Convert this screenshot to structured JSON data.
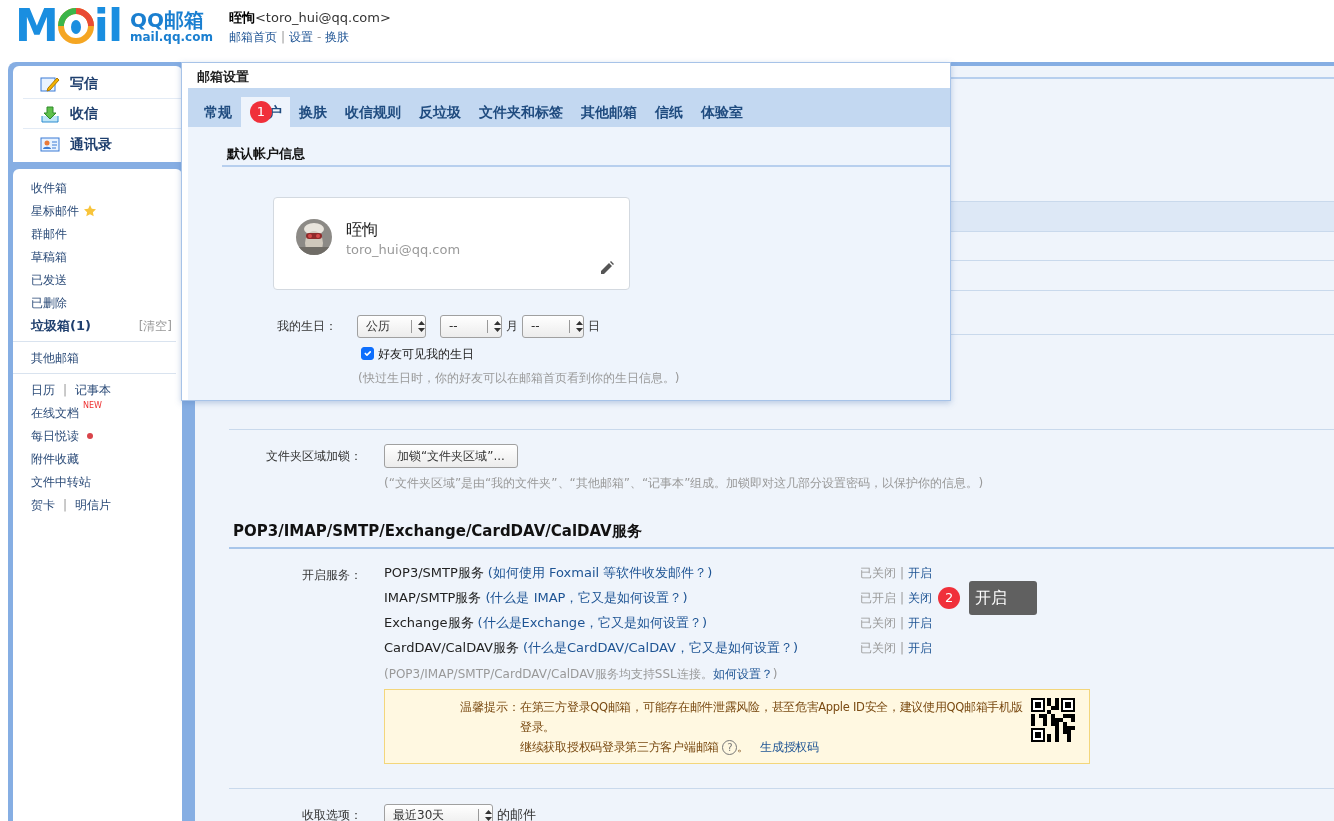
{
  "header": {
    "logo": {
      "mark_left": "M",
      "mark_right": "il",
      "name": "QQ邮箱",
      "domain": "mail.qq.com"
    },
    "user": {
      "name": "晊恂",
      "email": "<toro_hui@qq.com>"
    },
    "links": [
      {
        "kind": "link",
        "text": "邮箱首页"
      },
      {
        "kind": "sep",
        "text": "|"
      },
      {
        "kind": "link",
        "text": "设置"
      },
      {
        "kind": "sep",
        "text": "-"
      },
      {
        "kind": "link",
        "text": "换肤"
      }
    ]
  },
  "sidebar": {
    "actions": [
      {
        "kind": "compose",
        "label": "写信"
      },
      {
        "kind": "receive",
        "label": "收信"
      },
      {
        "kind": "contacts",
        "label": "通讯录"
      }
    ],
    "sections": [
      {
        "items": [
          {
            "kind": "plain",
            "label": "收件箱"
          },
          {
            "kind": "starred",
            "label": "星标邮件"
          },
          {
            "kind": "plain",
            "label": "群邮件"
          },
          {
            "kind": "plain",
            "label": "草稿箱"
          },
          {
            "kind": "plain",
            "label": "已发送"
          },
          {
            "kind": "plain",
            "label": "已删除"
          },
          {
            "kind": "junk",
            "label": "垃圾箱(1)",
            "action": "[清空]"
          }
        ]
      },
      {
        "items": [
          {
            "kind": "plain",
            "label": "其他邮箱"
          }
        ]
      },
      {
        "items": [
          {
            "kind": "pair",
            "labels": [
              "日历",
              "记事本"
            ],
            "separator": "|"
          },
          {
            "kind": "new",
            "label": "在线文档",
            "tag": "NEW"
          },
          {
            "kind": "dot",
            "label": "每日悦读"
          },
          {
            "kind": "plain",
            "label": "附件收藏"
          },
          {
            "kind": "plain",
            "label": "文件中转站"
          },
          {
            "kind": "pair",
            "labels": [
              "贺卡",
              "明信片"
            ],
            "separator": "|"
          }
        ]
      }
    ]
  },
  "popup": {
    "title": "邮箱设置",
    "tabs": [
      {
        "label": "常规",
        "selected": false
      },
      {
        "label": "户",
        "selected": true,
        "marker": "1"
      },
      {
        "label": "换肤",
        "selected": false
      },
      {
        "label": "收信规则",
        "selected": false
      },
      {
        "label": "反垃圾",
        "selected": false
      },
      {
        "label": "文件夹和标签",
        "selected": false
      },
      {
        "label": "其他邮箱",
        "selected": false
      },
      {
        "label": "信纸",
        "selected": false
      },
      {
        "label": "体验室",
        "selected": false
      }
    ],
    "section_title": "默认帐户信息",
    "account": {
      "name": "晊恂",
      "email": "toro_hui@qq.com"
    },
    "birthday": {
      "label": "我的生日：",
      "calendar": "公历",
      "month": "--",
      "month_unit": "月",
      "day": "--",
      "day_unit": "日",
      "visible": {
        "label": "好友可见我的生日",
        "checked": true
      },
      "hint": "(快过生日时，你的好友可以在邮箱首页看到你的生日信息。)"
    }
  },
  "folder_lock": {
    "label": "文件夹区域加锁：",
    "button": "加锁“文件夹区域”...",
    "hint": "(“文件夹区域”是由“我的文件夹”、“其他邮箱”、“记事本”组成。加锁即对这几部分设置密码，以保护你的信息。)"
  },
  "services": {
    "title": "POP3/IMAP/SMTP/Exchange/CardDAV/CalDAV服务",
    "label": "开启服务：",
    "rows": [
      {
        "name": "POP3/SMTP服务",
        "help": "(如何使用 Foxmail 等软件收发邮件？)",
        "status": "已关闭",
        "separator": "|",
        "action": "开启"
      },
      {
        "name": "IMAP/SMTP服务",
        "help": "(什么是 IMAP，它又是如何设置？)",
        "status": "已开启",
        "separator": "|",
        "action": "关闭",
        "callout": {
          "marker": "2",
          "text": "开启"
        }
      },
      {
        "name": "Exchange服务",
        "help": "(什么是Exchange，它又是如何设置？)",
        "status": "已关闭",
        "separator": "|",
        "action": "开启"
      },
      {
        "name": "CardDAV/CalDAV服务",
        "help": "(什么是CardDAV/CalDAV，它又是如何设置？)",
        "status": "已关闭",
        "separator": "|",
        "action": "开启"
      }
    ],
    "hint": {
      "text": "(POP3/IMAP/SMTP/CardDAV/CalDAV服务均支持SSL连接。",
      "link": "如何设置？",
      "tail": ")"
    },
    "notice": {
      "label": "温馨提示：",
      "line1": "在第三方登录QQ邮箱，可能存在邮件泄露风险，甚至危害Apple ID安全，建议使用QQ邮箱手机版登录。",
      "line2": "继续获取授权码登录第三方客户端邮箱",
      "help": "?",
      "after": "。",
      "link": "生成授权码"
    }
  },
  "receive": {
    "label": "收取选项：",
    "value": "最近30天",
    "suffix": "的邮件"
  }
}
